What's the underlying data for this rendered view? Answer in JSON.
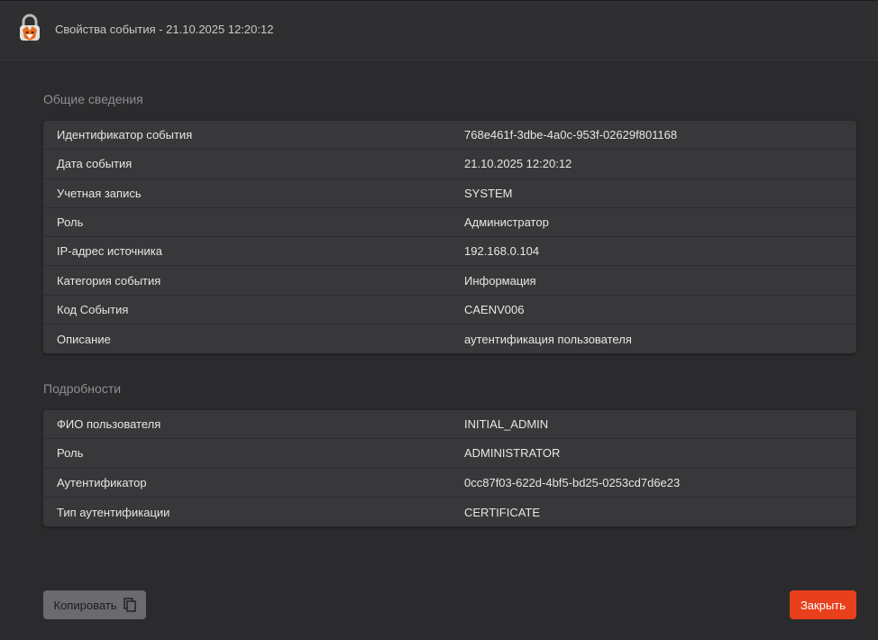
{
  "window": {
    "title": "Свойства события - 21.10.2025 12:20:12",
    "logo_icon": "lock-fox-logo-icon"
  },
  "general": {
    "title": "Общие сведения",
    "rows": [
      {
        "key": "Идентификатор события",
        "value": "768e461f-3dbe-4a0c-953f-02629f801168"
      },
      {
        "key": "Дата события",
        "value": "21.10.2025 12:20:12"
      },
      {
        "key": "Учетная запись",
        "value": "SYSTEM"
      },
      {
        "key": "Роль",
        "value": "Администратор"
      },
      {
        "key": "IP-адрес источника",
        "value": "192.168.0.104"
      },
      {
        "key": "Категория события",
        "value": "Информация"
      },
      {
        "key": "Код События",
        "value": "CAENV006"
      },
      {
        "key": "Описание",
        "value": "аутентификация пользователя"
      }
    ]
  },
  "details": {
    "title": "Подробности",
    "rows": [
      {
        "key": "ФИО пользователя",
        "value": "INITIAL_ADMIN"
      },
      {
        "key": "Роль",
        "value": "ADMINISTRATOR"
      },
      {
        "key": "Аутентификатор",
        "value": "0cc87f03-622d-4bf5-bd25-0253cd7d6e23"
      },
      {
        "key": "Тип аутентификации",
        "value": "CERTIFICATE"
      }
    ]
  },
  "footer": {
    "copy_label": "Копировать",
    "copy_icon": "copy-icon",
    "close_label": "Закрыть"
  },
  "colors": {
    "background": "#2b2b2d",
    "table": "#38383b",
    "accent": "#e8401c",
    "copy_button": "#6b6b6e"
  }
}
